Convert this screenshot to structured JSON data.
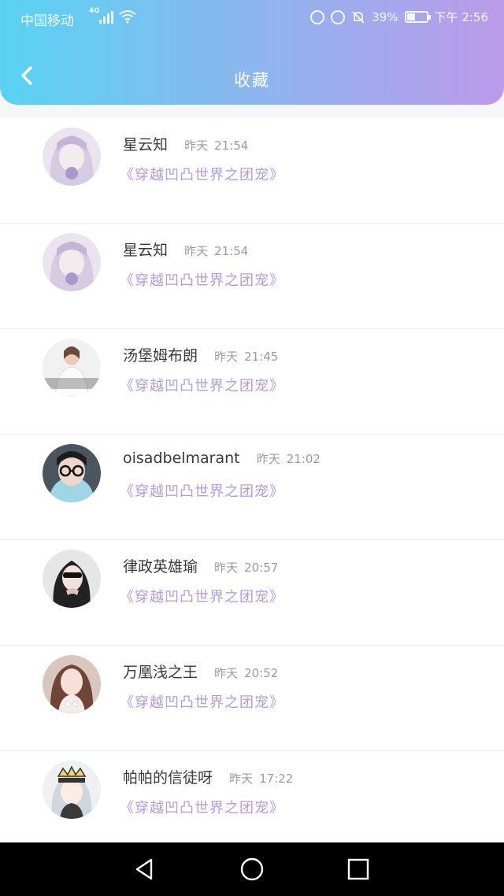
{
  "status_bar": {
    "carrier": "中国移动",
    "network": "4G",
    "battery": "39%",
    "time": "下午 2:56",
    "icons": [
      "signal-icon",
      "wifi-icon",
      "data-saver-icon",
      "alarm-icon",
      "mute-icon",
      "battery-icon"
    ]
  },
  "header": {
    "title": "收藏",
    "back_icon": "chevron-left-icon"
  },
  "items": [
    {
      "name": "星云知",
      "date": "昨天",
      "time": "21:54",
      "quote": "《穿越凹凸世界之团宠》",
      "avatar": "anime-girl-purple"
    },
    {
      "name": "星云知",
      "date": "昨天",
      "time": "21:54",
      "quote": "《穿越凹凸世界之团宠》",
      "avatar": "anime-girl-purple"
    },
    {
      "name": "汤堡姆布朗",
      "date": "昨天",
      "time": "21:45",
      "quote": "《穿越凹凸世界之团宠》",
      "avatar": "girl-photo"
    },
    {
      "name": "oisadbelmarant",
      "date": "昨天",
      "time": "21:02",
      "quote": "《穿越凹凸世界之团宠》",
      "avatar": "boy-glasses"
    },
    {
      "name": "律政英雄瑜",
      "date": "昨天",
      "time": "20:57",
      "quote": "《穿越凹凸世界之团宠》",
      "avatar": "sunglasses-girl"
    },
    {
      "name": "万凰浅之王",
      "date": "昨天",
      "time": "20:52",
      "quote": "《穿越凹凸世界之团宠》",
      "avatar": "girl-bow"
    },
    {
      "name": "帕帕的信徒呀",
      "date": "昨天",
      "time": "17:22",
      "quote": "《穿越凹凸世界之团宠》",
      "avatar": "anime-crown"
    }
  ],
  "nav": {
    "icons": [
      "back-triangle-icon",
      "home-circle-icon",
      "recents-square-icon"
    ]
  }
}
